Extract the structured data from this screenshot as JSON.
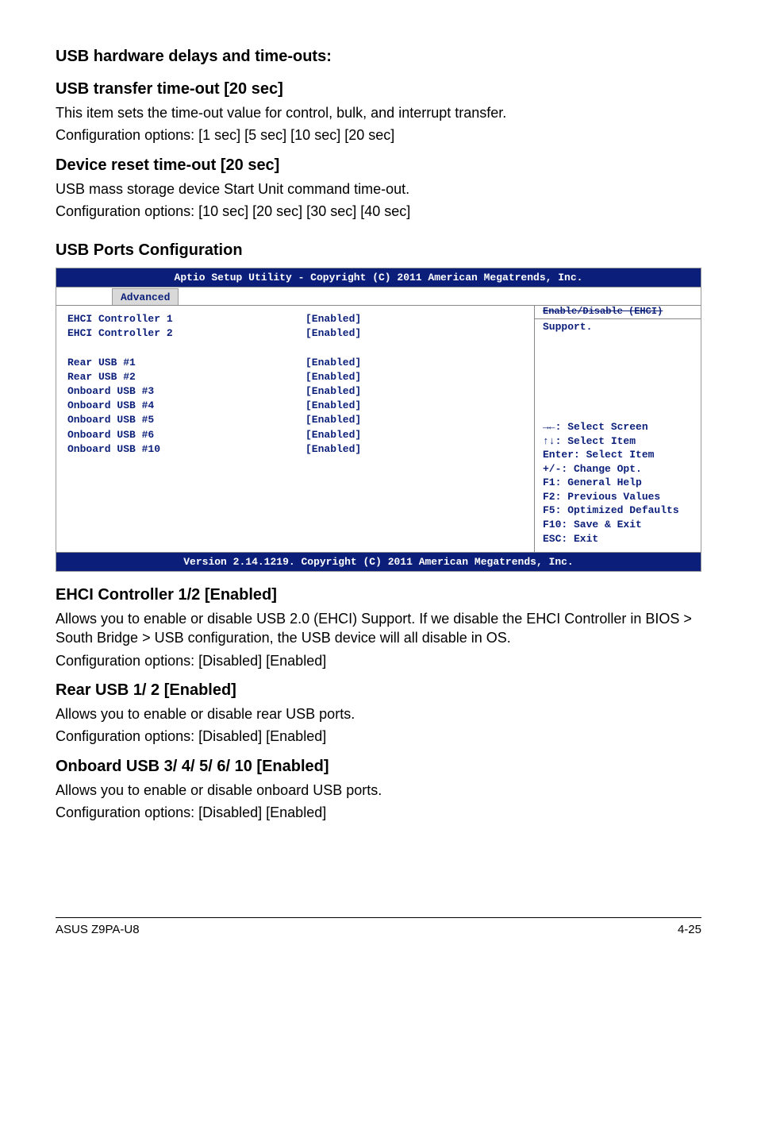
{
  "sections": {
    "s1": {
      "title": "USB hardware delays and time-outs:"
    },
    "s2": {
      "title": "USB transfer time-out [20 sec]",
      "p1": "This item sets the time-out value for control, bulk, and interrupt transfer.",
      "p2": "Configuration options: [1 sec] [5 sec] [10 sec] [20 sec]"
    },
    "s3": {
      "title": "Device reset time-out [20 sec]",
      "p1": "USB mass storage device Start Unit command time-out.",
      "p2": "Configuration options: [10 sec] [20 sec] [30 sec] [40 sec]"
    },
    "s4": {
      "title": "USB Ports Configuration"
    },
    "s5": {
      "title": "EHCI Controller 1/2 [Enabled]",
      "p1": "Allows you to enable or disable USB 2.0 (EHCI) Support. If we disable the EHCI Controller in BIOS > South Bridge > USB configuration, the USB device will all disable in OS.",
      "p2": "Configuration options: [Disabled] [Enabled]"
    },
    "s6": {
      "title": "Rear USB 1/ 2 [Enabled]",
      "p1": "Allows you to enable or disable rear USB ports.",
      "p2": "Configuration options: [Disabled] [Enabled]"
    },
    "s7": {
      "title": "Onboard USB 3/ 4/ 5/ 6/ 10 [Enabled]",
      "p1": "Allows you to enable or disable onboard USB ports.",
      "p2": "Configuration options: [Disabled] [Enabled]"
    }
  },
  "bios": {
    "header": "Aptio Setup Utility - Copyright (C) 2011 American Megatrends, Inc.",
    "tab": "Advanced",
    "rows": [
      {
        "label": "EHCI Controller 1",
        "value": "[Enabled]"
      },
      {
        "label": "EHCI Controller 2",
        "value": "[Enabled]"
      }
    ],
    "rows2": [
      {
        "label": "Rear USB #1",
        "value": "[Enabled]"
      },
      {
        "label": "Rear USB #2",
        "value": "[Enabled]"
      },
      {
        "label": "Onboard USB #3",
        "value": "[Enabled]"
      },
      {
        "label": "Onboard USB #4",
        "value": "[Enabled]"
      },
      {
        "label": "Onboard USB #5",
        "value": "[Enabled]"
      },
      {
        "label": "Onboard USB #6",
        "value": "[Enabled]"
      },
      {
        "label": "Onboard USB #10",
        "value": "[Enabled]"
      }
    ],
    "help_top_strike": "Enable/Disable (EHCI)",
    "help_support": "Support.",
    "keys": {
      "k1": "→←: Select Screen",
      "k2": "↑↓:  Select Item",
      "k3": "Enter: Select Item",
      "k4": "+/-: Change Opt.",
      "k5": "F1: General Help",
      "k6": "F2: Previous Values",
      "k7": "F5: Optimized Defaults",
      "k8": "F10: Save & Exit",
      "k9": "ESC: Exit"
    },
    "footer": "Version 2.14.1219. Copyright (C) 2011 American Megatrends, Inc."
  },
  "footer": {
    "left": "ASUS Z9PA-U8",
    "right": "4-25"
  }
}
